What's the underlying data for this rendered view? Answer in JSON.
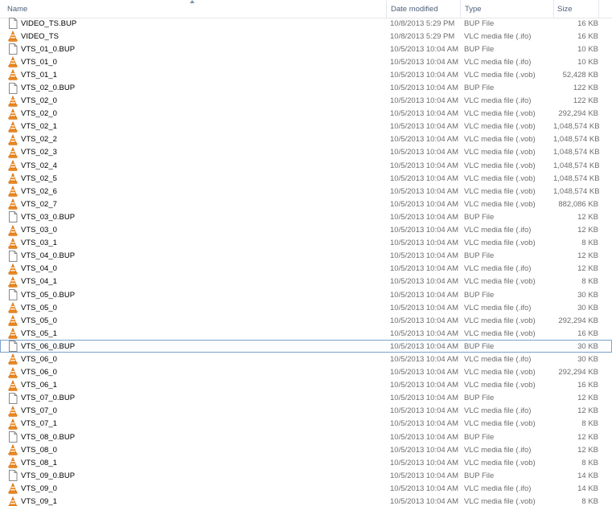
{
  "header": {
    "name": "Name",
    "date": "Date modified",
    "type": "Type",
    "size": "Size"
  },
  "colors": {
    "vlc_orange": "#f28c1e",
    "selection_border": "#7da2ce",
    "header_text": "#4c607a"
  },
  "icons": {
    "bup": "document-icon",
    "vlc": "vlc-cone-icon"
  },
  "files": [
    {
      "name": "VIDEO_TS.BUP",
      "date": "10/8/2013 5:29 PM",
      "type": "BUP File",
      "size": "16 KB",
      "icon": "bup"
    },
    {
      "name": "VIDEO_TS",
      "date": "10/8/2013 5:29 PM",
      "type": "VLC media file (.ifo)",
      "size": "16 KB",
      "icon": "vlc"
    },
    {
      "name": "VTS_01_0.BUP",
      "date": "10/5/2013 10:04 AM",
      "type": "BUP File",
      "size": "10 KB",
      "icon": "bup"
    },
    {
      "name": "VTS_01_0",
      "date": "10/5/2013 10:04 AM",
      "type": "VLC media file (.ifo)",
      "size": "10 KB",
      "icon": "vlc"
    },
    {
      "name": "VTS_01_1",
      "date": "10/5/2013 10:04 AM",
      "type": "VLC media file (.vob)",
      "size": "52,428 KB",
      "icon": "vlc"
    },
    {
      "name": "VTS_02_0.BUP",
      "date": "10/5/2013 10:04 AM",
      "type": "BUP File",
      "size": "122 KB",
      "icon": "bup"
    },
    {
      "name": "VTS_02_0",
      "date": "10/5/2013 10:04 AM",
      "type": "VLC media file (.ifo)",
      "size": "122 KB",
      "icon": "vlc"
    },
    {
      "name": "VTS_02_0",
      "date": "10/5/2013 10:04 AM",
      "type": "VLC media file (.vob)",
      "size": "292,294 KB",
      "icon": "vlc"
    },
    {
      "name": "VTS_02_1",
      "date": "10/5/2013 10:04 AM",
      "type": "VLC media file (.vob)",
      "size": "1,048,574 KB",
      "icon": "vlc"
    },
    {
      "name": "VTS_02_2",
      "date": "10/5/2013 10:04 AM",
      "type": "VLC media file (.vob)",
      "size": "1,048,574 KB",
      "icon": "vlc"
    },
    {
      "name": "VTS_02_3",
      "date": "10/5/2013 10:04 AM",
      "type": "VLC media file (.vob)",
      "size": "1,048,574 KB",
      "icon": "vlc"
    },
    {
      "name": "VTS_02_4",
      "date": "10/5/2013 10:04 AM",
      "type": "VLC media file (.vob)",
      "size": "1,048,574 KB",
      "icon": "vlc"
    },
    {
      "name": "VTS_02_5",
      "date": "10/5/2013 10:04 AM",
      "type": "VLC media file (.vob)",
      "size": "1,048,574 KB",
      "icon": "vlc"
    },
    {
      "name": "VTS_02_6",
      "date": "10/5/2013 10:04 AM",
      "type": "VLC media file (.vob)",
      "size": "1,048,574 KB",
      "icon": "vlc"
    },
    {
      "name": "VTS_02_7",
      "date": "10/5/2013 10:04 AM",
      "type": "VLC media file (.vob)",
      "size": "882,086 KB",
      "icon": "vlc"
    },
    {
      "name": "VTS_03_0.BUP",
      "date": "10/5/2013 10:04 AM",
      "type": "BUP File",
      "size": "12 KB",
      "icon": "bup"
    },
    {
      "name": "VTS_03_0",
      "date": "10/5/2013 10:04 AM",
      "type": "VLC media file (.ifo)",
      "size": "12 KB",
      "icon": "vlc"
    },
    {
      "name": "VTS_03_1",
      "date": "10/5/2013 10:04 AM",
      "type": "VLC media file (.vob)",
      "size": "8 KB",
      "icon": "vlc"
    },
    {
      "name": "VTS_04_0.BUP",
      "date": "10/5/2013 10:04 AM",
      "type": "BUP File",
      "size": "12 KB",
      "icon": "bup"
    },
    {
      "name": "VTS_04_0",
      "date": "10/5/2013 10:04 AM",
      "type": "VLC media file (.ifo)",
      "size": "12 KB",
      "icon": "vlc"
    },
    {
      "name": "VTS_04_1",
      "date": "10/5/2013 10:04 AM",
      "type": "VLC media file (.vob)",
      "size": "8 KB",
      "icon": "vlc"
    },
    {
      "name": "VTS_05_0.BUP",
      "date": "10/5/2013 10:04 AM",
      "type": "BUP File",
      "size": "30 KB",
      "icon": "bup"
    },
    {
      "name": "VTS_05_0",
      "date": "10/5/2013 10:04 AM",
      "type": "VLC media file (.ifo)",
      "size": "30 KB",
      "icon": "vlc"
    },
    {
      "name": "VTS_05_0",
      "date": "10/5/2013 10:04 AM",
      "type": "VLC media file (.vob)",
      "size": "292,294 KB",
      "icon": "vlc"
    },
    {
      "name": "VTS_05_1",
      "date": "10/5/2013 10:04 AM",
      "type": "VLC media file (.vob)",
      "size": "16 KB",
      "icon": "vlc"
    },
    {
      "name": "VTS_06_0.BUP",
      "date": "10/5/2013 10:04 AM",
      "type": "BUP File",
      "size": "30 KB",
      "icon": "bup",
      "selected": true
    },
    {
      "name": "VTS_06_0",
      "date": "10/5/2013 10:04 AM",
      "type": "VLC media file (.ifo)",
      "size": "30 KB",
      "icon": "vlc"
    },
    {
      "name": "VTS_06_0",
      "date": "10/5/2013 10:04 AM",
      "type": "VLC media file (.vob)",
      "size": "292,294 KB",
      "icon": "vlc"
    },
    {
      "name": "VTS_06_1",
      "date": "10/5/2013 10:04 AM",
      "type": "VLC media file (.vob)",
      "size": "16 KB",
      "icon": "vlc"
    },
    {
      "name": "VTS_07_0.BUP",
      "date": "10/5/2013 10:04 AM",
      "type": "BUP File",
      "size": "12 KB",
      "icon": "bup"
    },
    {
      "name": "VTS_07_0",
      "date": "10/5/2013 10:04 AM",
      "type": "VLC media file (.ifo)",
      "size": "12 KB",
      "icon": "vlc"
    },
    {
      "name": "VTS_07_1",
      "date": "10/5/2013 10:04 AM",
      "type": "VLC media file (.vob)",
      "size": "8 KB",
      "icon": "vlc"
    },
    {
      "name": "VTS_08_0.BUP",
      "date": "10/5/2013 10:04 AM",
      "type": "BUP File",
      "size": "12 KB",
      "icon": "bup"
    },
    {
      "name": "VTS_08_0",
      "date": "10/5/2013 10:04 AM",
      "type": "VLC media file (.ifo)",
      "size": "12 KB",
      "icon": "vlc"
    },
    {
      "name": "VTS_08_1",
      "date": "10/5/2013 10:04 AM",
      "type": "VLC media file (.vob)",
      "size": "8 KB",
      "icon": "vlc"
    },
    {
      "name": "VTS_09_0.BUP",
      "date": "10/5/2013 10:04 AM",
      "type": "BUP File",
      "size": "14 KB",
      "icon": "bup"
    },
    {
      "name": "VTS_09_0",
      "date": "10/5/2013 10:04 AM",
      "type": "VLC media file (.ifo)",
      "size": "14 KB",
      "icon": "vlc"
    },
    {
      "name": "VTS_09_1",
      "date": "10/5/2013 10:04 AM",
      "type": "VLC media file (.vob)",
      "size": "8 KB",
      "icon": "vlc"
    }
  ]
}
